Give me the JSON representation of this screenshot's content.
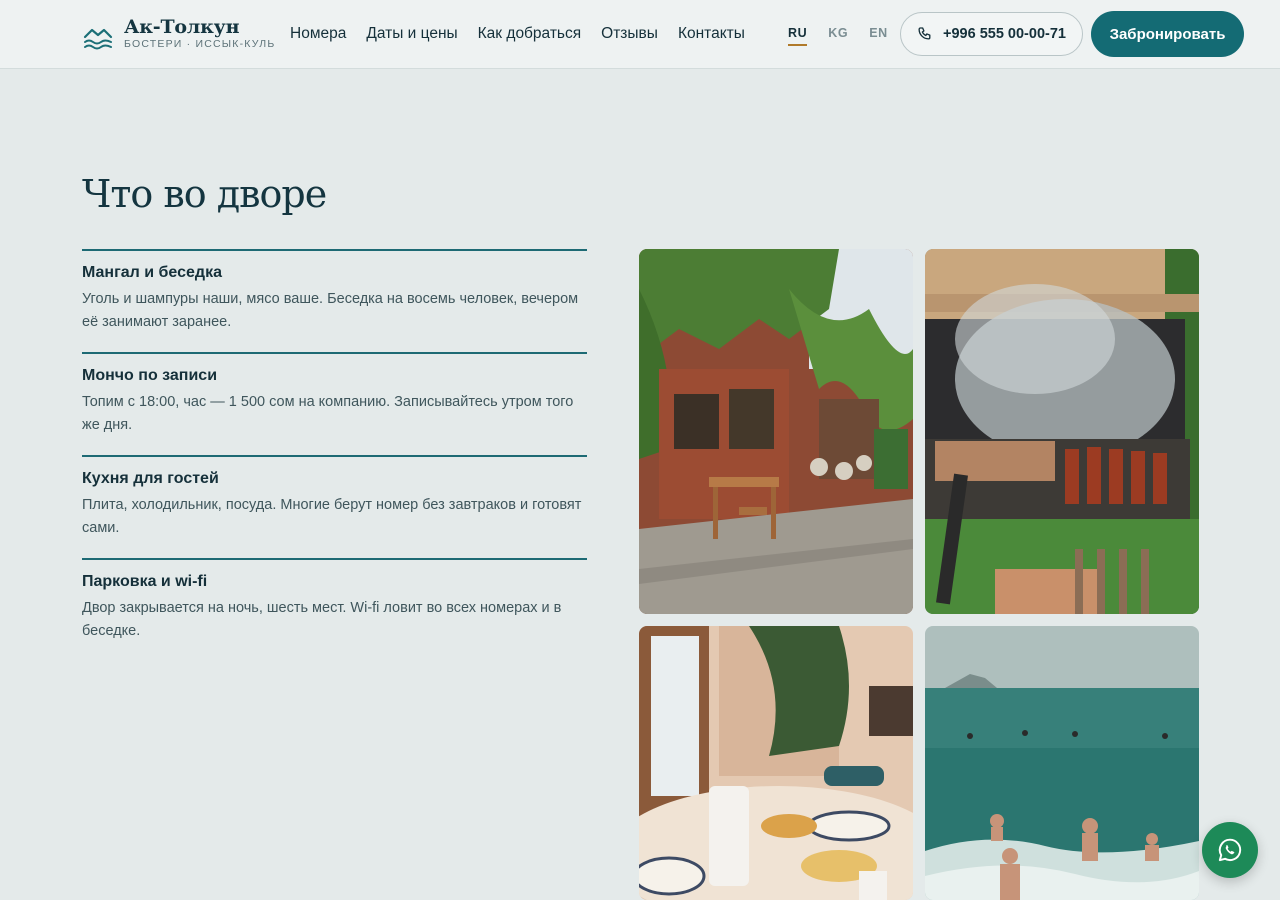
{
  "brand": {
    "name": "Ак-Толкун",
    "subtitle": "БОСТЕРИ · ИССЫК-КУЛЬ"
  },
  "nav": [
    "Номера",
    "Даты и цены",
    "Как добраться",
    "Отзывы",
    "Контакты"
  ],
  "languages": [
    {
      "code": "RU",
      "active": true
    },
    {
      "code": "KG",
      "active": false
    },
    {
      "code": "EN",
      "active": false
    }
  ],
  "phone": "+996 555 00-00-71",
  "book_label": "Забронировать",
  "section": {
    "title": "Что во дворе",
    "features": [
      {
        "title": "Мангал и беседка",
        "text": "Уголь и шампуры наши, мясо ваше. Беседка на восемь человек, вечером её занимают заранее."
      },
      {
        "title": "Мончо по записи",
        "text": "Топим с 18:00, час — 1 500 сом на компанию. Записывайтесь утром того же дня."
      },
      {
        "title": "Кухня для гостей",
        "text": "Плита, холодильник, посуда. Многие берут номер без завтраков и готовят сами."
      },
      {
        "title": "Парковка и wi-fi",
        "text": "Двор закрывается на ночь, шесть мест. Wi-fi ловит во всех номерах и в беседке."
      }
    ]
  },
  "colors": {
    "accent": "#146b74",
    "background": "#e4eaea",
    "whatsapp": "#1d8a58"
  },
  "icons": [
    "waves-logo-icon",
    "phone-icon",
    "whatsapp-icon"
  ]
}
